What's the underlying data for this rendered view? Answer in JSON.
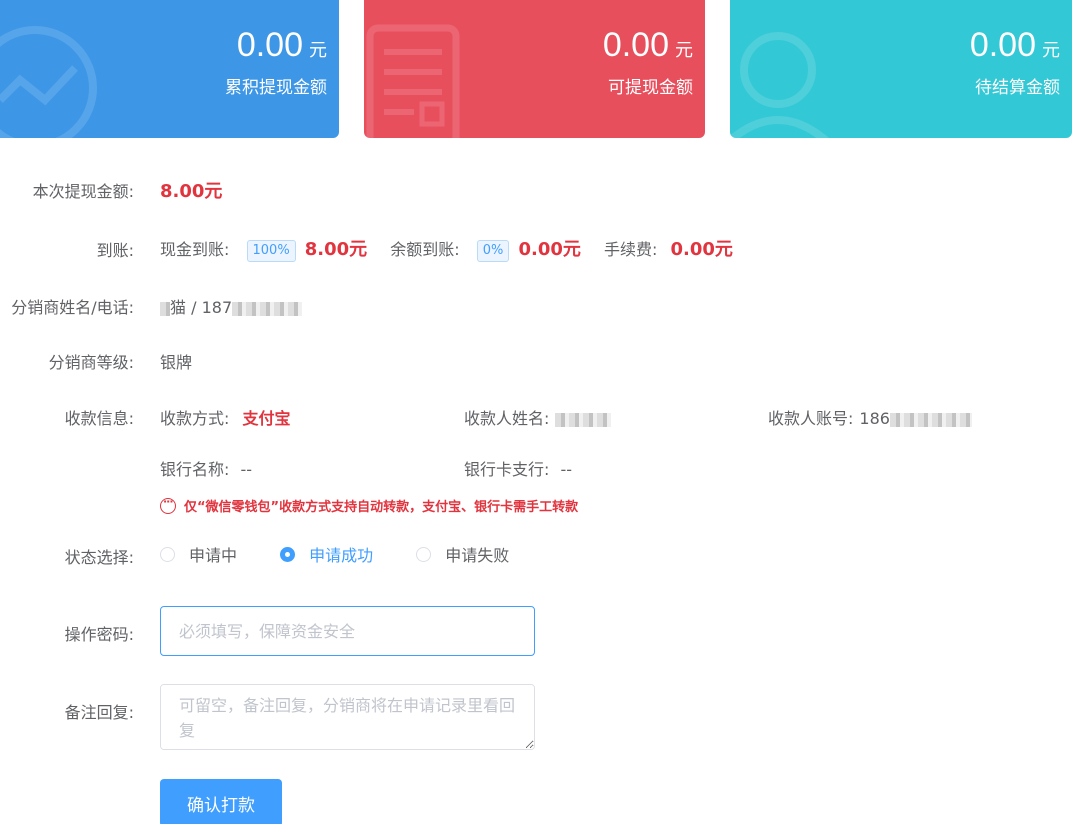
{
  "stats": [
    {
      "amount": "0.00",
      "unit": "元",
      "label": "累积提现金额",
      "color": "#3d97e6",
      "icon": "chart-icon"
    },
    {
      "amount": "0.00",
      "unit": "元",
      "label": "可提现金额",
      "color": "#e84f5d",
      "icon": "document-icon"
    },
    {
      "amount": "0.00",
      "unit": "元",
      "label": "待结算金额",
      "color": "#33c8d5",
      "icon": "user-icon"
    }
  ],
  "form": {
    "withdraw": {
      "label": "本次提现金额:",
      "value": "8.00元"
    },
    "arrival": {
      "label": "到账:",
      "cash_label": "现金到账:",
      "cash_percent": "100%",
      "cash_value": "8.00元",
      "balance_label": "余额到账:",
      "balance_percent": "0%",
      "balance_value": "0.00元",
      "fee_label": "手续费:",
      "fee_value": "0.00元"
    },
    "distributor": {
      "label": "分销商姓名/电话:",
      "name_prefix": "",
      "name_suffix": "猫",
      "separator": " / ",
      "phone_prefix": "187"
    },
    "level": {
      "label": "分销商等级:",
      "value": "银牌"
    },
    "payee": {
      "label": "收款信息:",
      "method_label": "收款方式:",
      "method_value": "支付宝",
      "name_label": "收款人姓名:",
      "account_label": "收款人账号:",
      "account_prefix": "186",
      "bank_label": "银行名称:",
      "bank_value": "--",
      "branch_label": "银行卡支行:",
      "branch_value": "--"
    },
    "notice": "仅“微信零钱包”收款方式支持自动转款，支付宝、银行卡需手工转款",
    "status": {
      "label": "状态选择:",
      "options": [
        "申请中",
        "申请成功",
        "申请失败"
      ],
      "selected": "申请成功"
    },
    "password": {
      "label": "操作密码:",
      "placeholder": "必须填写，保障资金安全"
    },
    "remark": {
      "label": "备注回复:",
      "placeholder": "可留空，备注回复，分销商将在申请记录里看回复"
    },
    "submit": "确认打款"
  },
  "colors": {
    "accent": "#409eff",
    "danger": "#e1343e"
  }
}
